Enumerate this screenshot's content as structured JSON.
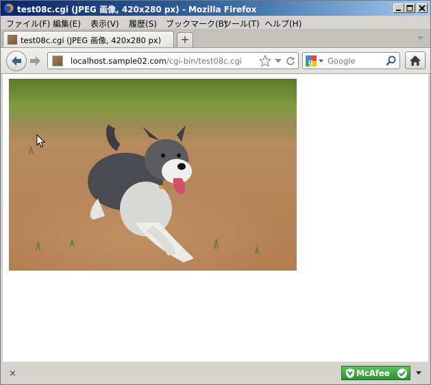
{
  "window": {
    "title": "test08c.cgi (JPEG 画像, 420x280 px) - Mozilla Firefox"
  },
  "menu": {
    "items": [
      "ファイル(F)",
      "編集(E)",
      "表示(V)",
      "履歴(S)",
      "ブックマーク(B)",
      "ツール(T)",
      "ヘルプ(H)"
    ]
  },
  "tab": {
    "title": "test08c.cgi (JPEG 画像, 420x280 px)",
    "new_tab_label": "+"
  },
  "nav": {
    "url_host": "localhost.sample02.com",
    "url_path": "/cgi-bin/test08c.cgi",
    "search_placeholder": "Google"
  },
  "status": {
    "close_label": "×",
    "mcafee_label": "McAfee"
  },
  "colors": {
    "mcafee_green": "#3aa63a",
    "titlebar_start": "#0a246a"
  }
}
